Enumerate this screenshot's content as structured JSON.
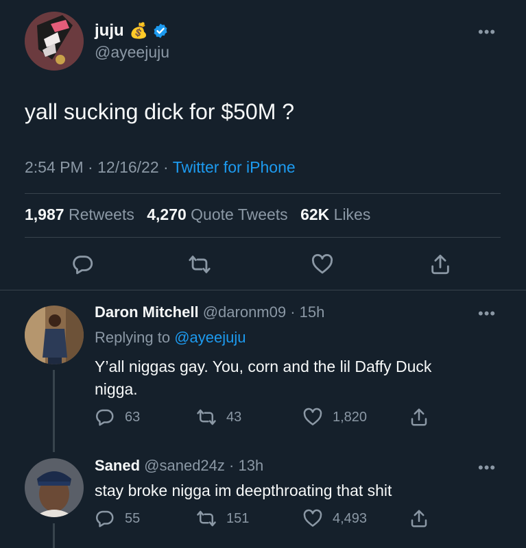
{
  "main_tweet": {
    "display_name": "juju",
    "handle": "@ayeejuju",
    "badge_emoji": "💰",
    "text": "yall sucking dick for $50M ?",
    "time": "2:54 PM",
    "date": "12/16/22",
    "source": "Twitter for iPhone",
    "sep": "·",
    "stats": {
      "retweets": "1,987",
      "retweets_label": "Retweets",
      "quotes": "4,270",
      "quotes_label": "Quote Tweets",
      "likes": "62K",
      "likes_label": "Likes"
    }
  },
  "replies": [
    {
      "display_name": "Daron Mitchell",
      "handle": "@daronm09",
      "time": "· 15h",
      "replying_prefix": "Replying to",
      "replying_to": "@ayeejuju",
      "text_line1": "Y’all niggas gay. You, corn and the lil Daffy Duck",
      "text_line2": "nigga.",
      "replies": "63",
      "retweets": "43",
      "likes": "1,820"
    },
    {
      "display_name": "Saned",
      "handle": "@saned24z",
      "time": "· 13h",
      "text_line1": "stay broke nigga im deepthroating that shit",
      "replies": "55",
      "retweets": "151",
      "likes": "4,493"
    }
  ],
  "colors": {
    "background": "#15202b",
    "text": "#f7f9f9",
    "muted": "#8b98a5",
    "accent": "#1d9bf0",
    "divider": "#38444d"
  },
  "icons": [
    "more-icon",
    "verified-icon",
    "money-bag-icon",
    "reply-icon",
    "retweet-icon",
    "like-icon",
    "share-icon"
  ]
}
